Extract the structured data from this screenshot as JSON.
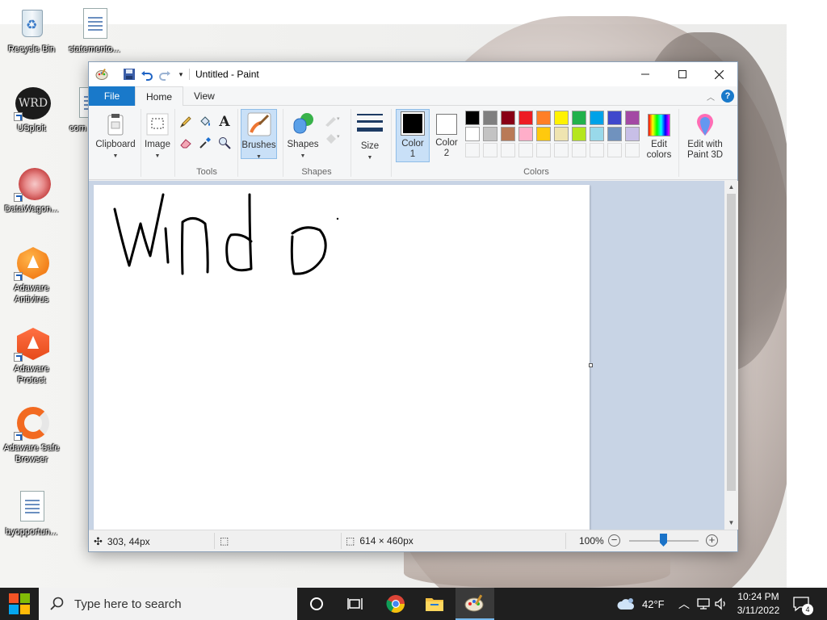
{
  "desktop": {
    "icons": [
      {
        "label": "Recycle Bin"
      },
      {
        "label": "statemento..."
      },
      {
        "label": "USploit"
      },
      {
        "label": "com"
      },
      {
        "label": "DataWagon..."
      },
      {
        "label": "Adaware Antivirus"
      },
      {
        "label": "Adaware Protect"
      },
      {
        "label": "Adaware Safe Browser"
      },
      {
        "label": "byopportun..."
      }
    ]
  },
  "window": {
    "title": "Untitled - Paint",
    "tabs": {
      "file": "File",
      "home": "Home",
      "view": "View"
    },
    "groups": {
      "clipboard": "Clipboard",
      "image": "Image",
      "tools": "Tools",
      "brushes": "Brushes",
      "shapes_btn": "Shapes",
      "shapes": "Shapes",
      "size": "Size",
      "color1": "Color 1",
      "color2": "Color 2",
      "colors": "Colors",
      "edit_colors": "Edit colors",
      "edit_paint3d": "Edit with Paint 3D"
    },
    "palette_row1": [
      "#000000",
      "#7f7f7f",
      "#880015",
      "#ed1c24",
      "#ff7f27",
      "#fff200",
      "#22b14c",
      "#00a2e8",
      "#3f48cc",
      "#a349a4"
    ],
    "palette_row2": [
      "#ffffff",
      "#c3c3c3",
      "#b97a57",
      "#ffaec9",
      "#ffc90e",
      "#efe4b0",
      "#b5e61d",
      "#99d9ea",
      "#7092be",
      "#c8bfe7"
    ],
    "color1": "#000000",
    "color2": "#ffffff",
    "status": {
      "cursor_pos": "303, 44px",
      "canvas_size": "614 × 460px",
      "zoom": "100%"
    }
  },
  "taskbar": {
    "search_placeholder": "Type here to search",
    "weather": "42°F",
    "time": "10:24 PM",
    "date": "3/11/2022",
    "notifications": "4"
  }
}
